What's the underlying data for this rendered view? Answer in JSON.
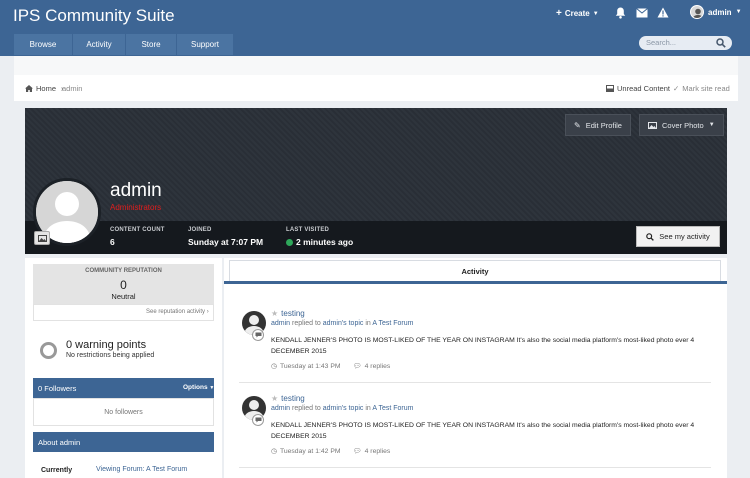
{
  "header": {
    "site_title": "IPS Community Suite",
    "create_label": "Create",
    "user_label": "admin",
    "nav_tabs": [
      {
        "label": "Browse"
      },
      {
        "label": "Activity"
      },
      {
        "label": "Store"
      },
      {
        "label": "Support"
      }
    ],
    "search_placeholder": "Search..."
  },
  "breadcrumb": {
    "home": "Home",
    "current": "admin",
    "unread": "Unread Content",
    "mark_read": "Mark site read"
  },
  "profile": {
    "name": "admin",
    "group": "Administrators",
    "edit_profile": "Edit Profile",
    "cover_photo": "Cover Photo",
    "stats": {
      "content_count_label": "CONTENT COUNT",
      "content_count": "6",
      "joined_label": "JOINED",
      "joined": "Sunday at 7:07 PM",
      "last_visited_label": "LAST VISITED",
      "last_visited": "2 minutes ago"
    },
    "see_activity": "See my activity"
  },
  "sidebar": {
    "reputation_label": "COMMUNITY REPUTATION",
    "reputation_value": "0",
    "reputation_level": "Neutral",
    "reputation_link": "See reputation activity",
    "warning_title": "0 warning points",
    "warning_sub": "No restrictions being applied",
    "followers_title": "0 Followers",
    "followers_options": "Options",
    "followers_empty": "No followers",
    "about_title": "About admin",
    "currently_label": "Currently",
    "currently_value": "Viewing Forum: A Test Forum"
  },
  "activity": {
    "tab_label": "Activity",
    "items": [
      {
        "title": "testing",
        "meta_user": "admin",
        "meta_mid": " replied to ",
        "meta_user2": "admin's topic",
        "meta_in": " in ",
        "meta_forum": "A Test Forum",
        "text": "KENDALL JENNER'S PHOTO IS MOST-LIKED OF THE YEAR ON INSTAGRAM It's also the social media platform's most-liked photo ever 4 DECEMBER 2015",
        "time": "Tuesday at 1:43 PM",
        "replies": "4 replies"
      },
      {
        "title": "testing",
        "meta_user": "admin",
        "meta_mid": " replied to ",
        "meta_user2": "admin's topic",
        "meta_in": " in ",
        "meta_forum": "A Test Forum",
        "text": "KENDALL JENNER'S PHOTO IS MOST-LIKED OF THE YEAR ON INSTAGRAM It's also the social media platform's most-liked photo ever 4 DECEMBER 2015",
        "time": "Tuesday at 1:42 PM",
        "replies": "4 replies"
      }
    ]
  },
  "colors": {
    "brand": "#3d6594",
    "group_red": "#e21d1d",
    "online_green": "#2ea85a"
  }
}
